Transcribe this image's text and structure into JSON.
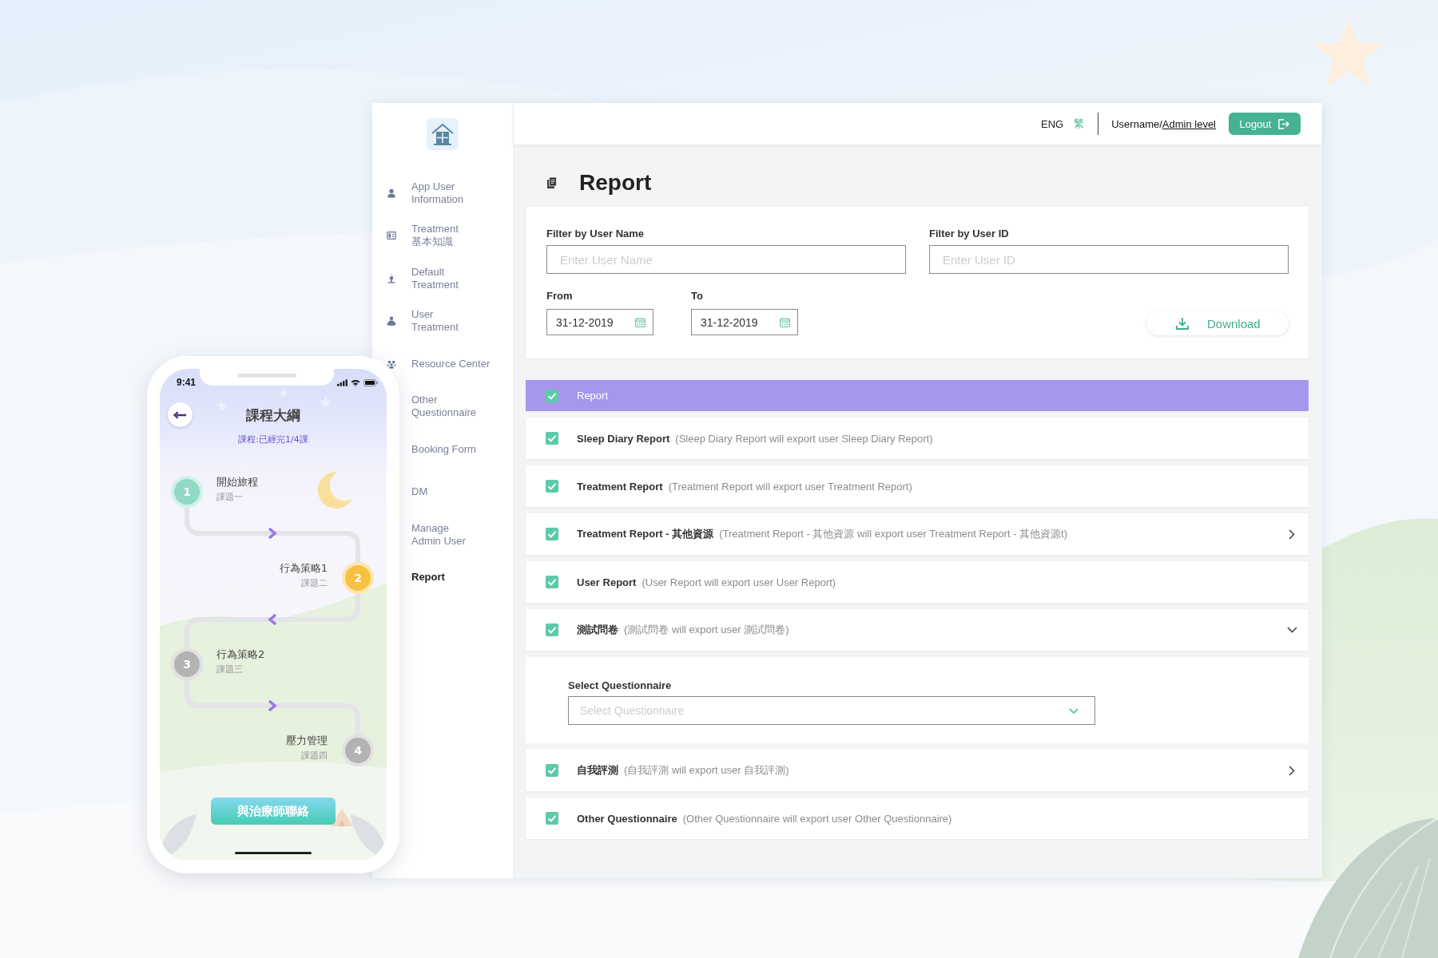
{
  "sidebar": {
    "items": [
      {
        "label": "App User\nInformation",
        "selected": false
      },
      {
        "label": "Treatment\n基本知識",
        "selected": false
      },
      {
        "label": "Default\nTreatment",
        "selected": false
      },
      {
        "label": "User\nTreatment",
        "selected": false
      },
      {
        "label": "Resource Center",
        "selected": false
      },
      {
        "label": "Other\nQuestionnaire",
        "selected": false
      },
      {
        "label": "Booking Form",
        "selected": false
      },
      {
        "label": "DM",
        "selected": false
      },
      {
        "label": "Manage\nAdmin User",
        "selected": false
      },
      {
        "label": "Report",
        "selected": true
      }
    ]
  },
  "top_bar": {
    "languages": [
      {
        "label": "ENG",
        "selected": true
      },
      {
        "label": "繁",
        "selected": false
      }
    ],
    "username": "Username/",
    "admin_level": "Admin level",
    "logout_button": "Logout"
  },
  "page_title": "Report",
  "filters": {
    "user_name": {
      "label": "Filter by User Name",
      "placeholder": "Enter User Name"
    },
    "user_id": {
      "label": "Filter by User ID",
      "placeholder": "Enter User ID"
    },
    "from": {
      "label": "From",
      "value": "31-12-2019"
    },
    "to": {
      "label": "To",
      "value": "31-12-2019"
    },
    "download_button": "Download"
  },
  "report_list": {
    "header": {
      "label": "Report",
      "checked": true
    },
    "items": [
      {
        "kind": "plain",
        "title": "Sleep Diary Report",
        "description": "(Sleep Diary Report will export user Sleep Diary Report)",
        "checked": true
      },
      {
        "kind": "plain",
        "title": "Treatment Report",
        "description": "(Treatment Report will export user Treatment Report)",
        "checked": true
      },
      {
        "kind": "expandable",
        "title": "Treatment Report - 其他資源",
        "description": "(Treatment Report - 其他資源 will export user Treatment Report - 其他資源t)",
        "checked": true,
        "expanded": false
      },
      {
        "kind": "plain",
        "title": "User Report",
        "description": "(User Report will export user User Report)",
        "checked": true
      },
      {
        "kind": "expandable",
        "title": "測試問卷",
        "description": "(測試問卷 will export user 測試問卷)",
        "checked": true,
        "expanded": true,
        "select": {
          "label": "Select Questionnaire",
          "placeholder": "Select Questionnaire"
        }
      },
      {
        "kind": "expandable",
        "title": "自我評測",
        "description": "(自我評測 will export user 自我評測)",
        "checked": true,
        "expanded": false
      },
      {
        "kind": "plain",
        "title": "Other Questionnaire",
        "description": "(Other Questionnaire will export user Other Questionnaire)",
        "checked": true
      }
    ]
  },
  "phone": {
    "status_time": "9:41",
    "title": "課程大綱",
    "subtitle": "課程:已經完1/4課",
    "lessons": [
      {
        "number": "1",
        "title": "開始旅程",
        "subtitle": "課題一",
        "color": "#8fd9c5"
      },
      {
        "number": "2",
        "title": "行為策略1",
        "subtitle": "課題二",
        "color": "#f7c242"
      },
      {
        "number": "3",
        "title": "行為策略2",
        "subtitle": "課題三",
        "color": "#b3b3b3"
      },
      {
        "number": "4",
        "title": "壓力管理",
        "subtitle": "課題四",
        "color": "#b3b3b3"
      }
    ],
    "contact_button": "與治療師聯絡"
  }
}
